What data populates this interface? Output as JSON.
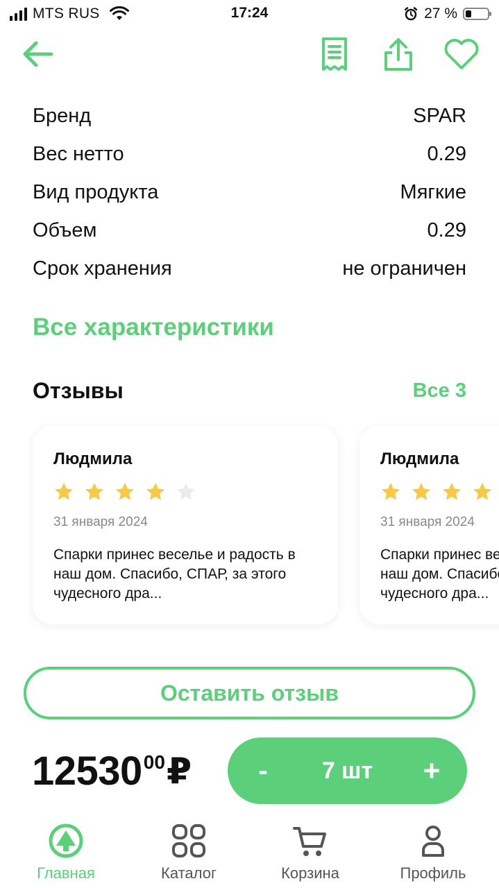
{
  "status_bar": {
    "carrier": "MTS RUS",
    "time": "17:24",
    "battery_percent": "27 %",
    "battery_level": 0.27,
    "icons": [
      "signal-icon",
      "wifi-icon",
      "alarm-icon",
      "battery-icon"
    ]
  },
  "nav": {
    "icons": [
      "back-arrow-icon",
      "receipt-icon",
      "share-icon",
      "heart-icon"
    ],
    "accent_color": "#5ccf7a"
  },
  "specs": [
    {
      "label": "Бренд",
      "value": "SPAR"
    },
    {
      "label": "Вес нетто",
      "value": "0.29"
    },
    {
      "label": "Вид продукта",
      "value": "Мягкие"
    },
    {
      "label": "Объем",
      "value": "0.29"
    },
    {
      "label": "Срок хранения",
      "value": "не ограничен"
    }
  ],
  "all_characteristics_label": "Все характеристики",
  "reviews": {
    "title": "Отзывы",
    "all_label": "Все 3",
    "items": [
      {
        "author": "Людмила",
        "rating": 4,
        "max_rating": 5,
        "date": "31 января 2024",
        "text": "Спарки принес веселье и радость в наш дом. Спасибо, СПАР, за этого чудесного дра..."
      },
      {
        "author": "Людмила",
        "rating": 4,
        "max_rating": 5,
        "date": "31 января 2024",
        "text": "Спарки принес веселье и радость в наш дом. Спасибо, СПАР, за этого чудесного дра..."
      }
    ]
  },
  "leave_review_label": "Оставить отзыв",
  "price": {
    "integer": "12530",
    "decimal": "00",
    "currency": "₽"
  },
  "quantity": {
    "minus": "-",
    "value": "7 шт",
    "plus": "+"
  },
  "tabbar": [
    {
      "label": "Главная",
      "icon": "spar-tree-icon",
      "active": true
    },
    {
      "label": "Каталог",
      "icon": "grid-icon",
      "active": false
    },
    {
      "label": "Корзина",
      "icon": "cart-icon",
      "active": false
    },
    {
      "label": "Профиль",
      "icon": "profile-icon",
      "active": false
    }
  ],
  "colors": {
    "accent": "#5ccf7a",
    "star_filled": "#f7c948",
    "star_empty": "#ececec",
    "text": "#111111",
    "muted": "#8a8a8a"
  }
}
